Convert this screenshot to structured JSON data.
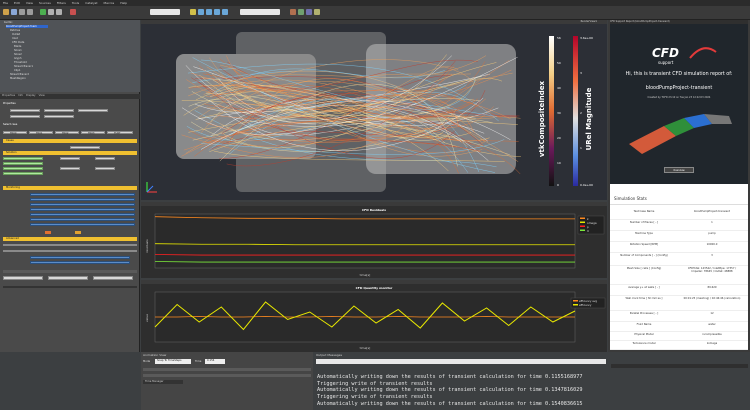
{
  "menu": [
    "File",
    "Edit",
    "View",
    "Sources",
    "Filters",
    "Tools",
    "Catalyst",
    "Macros",
    "Help"
  ],
  "pipeline": {
    "items": [
      "builtin:",
      "bloodPumpProject.foam",
      "Patches",
      "Outlet",
      "Inlet",
      "CFD Data",
      "Blade",
      "Slice1",
      "Slice2",
      "Glyph",
      "Threshold",
      "StreamTracer1",
      "Clip1",
      "StreamTracer2",
      "MeshRegion"
    ],
    "selected": "bloodPumpProject.foam"
  },
  "panel_tabs": [
    "Properties",
    "Info",
    "Display",
    "View"
  ],
  "sections": {
    "properties": "Properties",
    "cases": "Cases",
    "select_case": "Select case",
    "solution": "Solution",
    "monitoring": "Monitoring",
    "advanced": "Advanced",
    "time_step": "Time step"
  },
  "case_buttons": [
    "TR00",
    "TR01",
    "TR02",
    "TR03",
    "TURT"
  ],
  "viewport": {
    "title": "RenderView1",
    "colorbar1_label": "vtkCompositeIndex",
    "colorbar2_label": "URel Magnitude",
    "colorbar1_ticks": [
      "56",
      "50",
      "40",
      "30",
      "20",
      "10",
      "0"
    ],
    "colorbar2_ticks": [
      "3.6e+00",
      "3",
      "2",
      "1",
      "0.0e+00"
    ]
  },
  "residuals": {
    "title": "CFD Residuals",
    "ylabel": "residuals",
    "xlabel": "time[s]",
    "legend": [
      "k",
      "omega",
      "p",
      "U"
    ]
  },
  "quantity": {
    "title": "CFD Quantity monitor",
    "ylabel": "value",
    "xlabel": "time[s]",
    "legend": [
      "efficiency avg",
      "efficiency"
    ]
  },
  "report": {
    "tab": "CFD Support Report (bloodPumpProject-transient)",
    "logo_text": "CFD",
    "logo_sub": "support",
    "greeting": "Hi, this is transient CFD simulation report of:",
    "project": "bloodPumpProject-transient",
    "created": "Created by TCFD 23.10 on Tue Jan 23 12:22:03 2024",
    "button": "Overview",
    "stats_title": "Simulation Stats",
    "rows": [
      {
        "k": "Test Case Name",
        "v": "bloodPumpProject-transient"
      },
      {
        "k": "Number of Places [ - ]",
        "v": "1"
      },
      {
        "k": "Machine Type",
        "v": "pump"
      },
      {
        "k": "Rotation Speed [RPM]",
        "v": "10000.0"
      },
      {
        "k": "Number of Components [ - ] (Config)",
        "v": "3"
      },
      {
        "k": "Mesh Size [ cells ] (Config)",
        "v": "CFDTotal: 143542 / InletPipe: 17357 / Impeller: 78645 / Outlet: 48888"
      },
      {
        "k": "Average y+ at walls [ - ]",
        "v": "89.629"
      },
      {
        "k": "Wall clock time [ hh:mm:ss ]",
        "v": "00:01:25 (meshing) / 02:46:46 (calculation)"
      },
      {
        "k": "Parallel Processes [ - ]",
        "v": "12"
      },
      {
        "k": "Fluid Name",
        "v": "water"
      },
      {
        "k": "Physical Model",
        "v": "incompressible"
      },
      {
        "k": "Turbulence model",
        "v": "komega"
      }
    ]
  },
  "animation": {
    "title": "Animation View",
    "mode_label": "Mode",
    "mode_value": "Snap To TimeSteps",
    "time_label": "Time",
    "time_value": "0.154",
    "tab": "Time Manager"
  },
  "console": {
    "title": "Output Messages",
    "lines": [
      "Automatically writing down the results of transient calculation for time 0.1155168977",
      "Triggering write of transient results",
      "Automatically writing down the results of transient calculation for time 0.1347816029",
      "Triggering write of transient results",
      "Automatically writing down the results of transient calculation for time 0.1540836615"
    ]
  },
  "colors": {
    "accent_yellow": "#f0c030",
    "selection_blue": "#2f65ca",
    "series_yellow": "#e8e800",
    "series_orange": "#ff8a1f",
    "series_red": "#ff2020",
    "series_green": "#7be83b"
  },
  "chart_data": [
    {
      "type": "line",
      "title": "CFD Residuals",
      "ylabel": "residuals",
      "xlabel": "time[s]",
      "series": [
        {
          "name": "k",
          "values": [
            0.95,
            0.93,
            0.92,
            0.92,
            0.91,
            0.91,
            0.91,
            0.91,
            0.91,
            0.91
          ]
        },
        {
          "name": "omega",
          "values": [
            0.45,
            0.44,
            0.44,
            0.43,
            0.43,
            0.43,
            0.43,
            0.43,
            0.43,
            0.43
          ]
        },
        {
          "name": "p",
          "values": [
            0.25,
            0.24,
            0.24,
            0.24,
            0.24,
            0.24,
            0.24,
            0.24,
            0.24,
            0.24
          ]
        },
        {
          "name": "U",
          "values": [
            0.12,
            0.11,
            0.11,
            0.11,
            0.11,
            0.11,
            0.11,
            0.11,
            0.11,
            0.11
          ]
        }
      ]
    },
    {
      "type": "line",
      "title": "CFD Quantity monitor",
      "ylabel": "value",
      "xlabel": "time[s]",
      "series": [
        {
          "name": "efficiency avg",
          "values": [
            0.5,
            0.5,
            0.51,
            0.5,
            0.5,
            0.51,
            0.5,
            0.5,
            0.51,
            0.5,
            0.5,
            0.51,
            0.5,
            0.5,
            0.5,
            0.51,
            0.5,
            0.5,
            0.5,
            0.5
          ]
        },
        {
          "name": "efficiency",
          "values": [
            0.3,
            0.75,
            0.4,
            0.7,
            0.25,
            0.8,
            0.45,
            0.6,
            0.3,
            0.72,
            0.38,
            0.65,
            0.28,
            0.78,
            0.42,
            0.68,
            0.33,
            0.7,
            0.4,
            0.62
          ]
        }
      ]
    }
  ]
}
